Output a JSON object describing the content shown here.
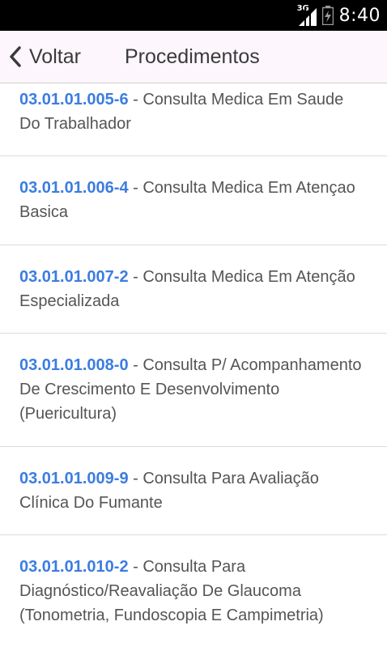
{
  "status_bar": {
    "network": "3G",
    "time": "8:40",
    "icons": [
      "signal-icon",
      "battery-icon"
    ]
  },
  "app_bar": {
    "back_label": "Voltar",
    "title": "Procedimentos"
  },
  "procedures": [
    {
      "code": "03.01.01.005-6",
      "separator": " - ",
      "name": "Consulta Medica Em Saude Do Trabalhador"
    },
    {
      "code": "03.01.01.006-4",
      "separator": " - ",
      "name": "Consulta Medica Em Atençao Basica"
    },
    {
      "code": "03.01.01.007-2",
      "separator": " - ",
      "name": "Consulta Medica Em Atenção Especializada"
    },
    {
      "code": "03.01.01.008-0",
      "separator": " - ",
      "name": "Consulta P/ Acompanhamento De Crescimento E Desenvolvimento (Puericultura)"
    },
    {
      "code": "03.01.01.009-9",
      "separator": " - ",
      "name": "Consulta Para Avaliação Clínica Do Fumante"
    },
    {
      "code": "03.01.01.010-2",
      "separator": " - ",
      "name": "Consulta Para Diagnóstico/Reavaliação De Glaucoma (Tonometria, Fundoscopia E Campimetria)"
    }
  ],
  "colors": {
    "code": "#3b7de0",
    "text": "#555555",
    "app_bar_bg": "#fdf7fd",
    "status_bar_bg": "#000000"
  }
}
